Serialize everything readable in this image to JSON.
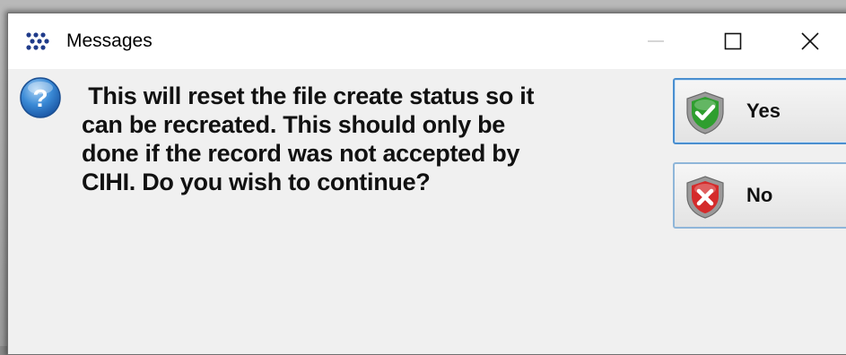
{
  "window": {
    "title": "Messages",
    "controls": {
      "minimize": "minimize-icon",
      "maximize": "maximize-icon",
      "close": "close-icon"
    }
  },
  "dialog": {
    "icon": "question-icon",
    "message": " This will reset the file create status so it\ncan be recreated. This should only be\ndone if the record was not accepted by\nCIHI. Do you wish to continue?",
    "buttons": {
      "yes_label": "Yes",
      "yes_icon": "shield-check-icon",
      "no_label": "No",
      "no_icon": "shield-x-icon"
    }
  },
  "colors": {
    "accent_border": "#4a8fd0",
    "check_green": "#2f9e2f",
    "cross_red": "#d42b2b",
    "question_blue": "#3a8ad6"
  }
}
